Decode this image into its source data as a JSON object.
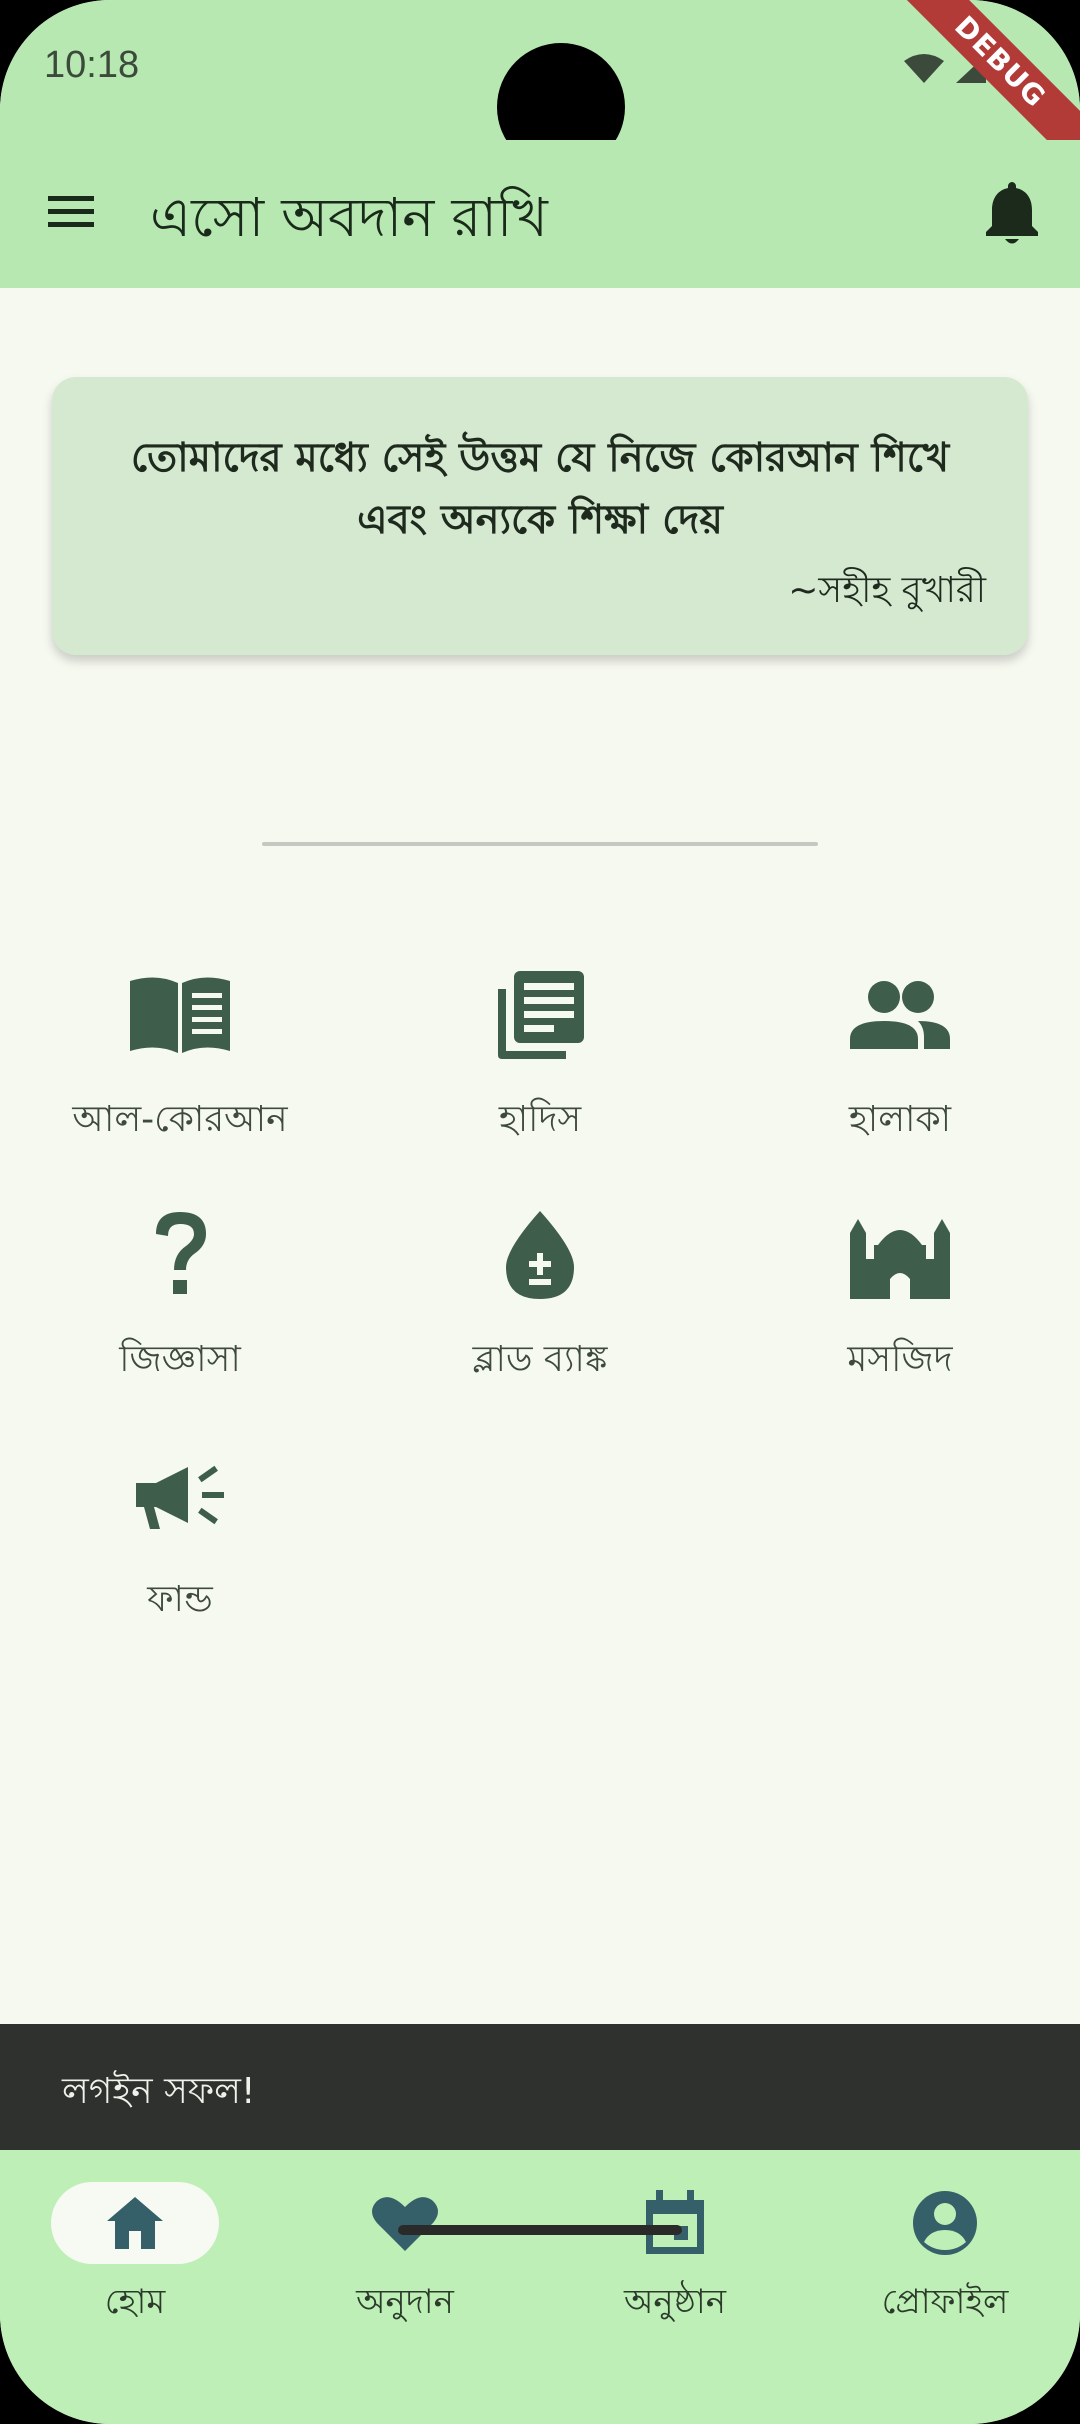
{
  "status_bar": {
    "time": "10:18",
    "debug_label": "DEBUG"
  },
  "app_bar": {
    "title": "এসো অবদান রাখি"
  },
  "quote": {
    "text": "তোমাদের মধ্যে সেই উত্তম যে নিজে কোরআন শিখে এবং অন্যকে শিক্ষা দেয়",
    "source": "~সহীহ বুখারী"
  },
  "grid": [
    {
      "label": "আল-কোরআন",
      "icon": "book-open-icon"
    },
    {
      "label": "হাদিস",
      "icon": "article-stack-icon"
    },
    {
      "label": "হালাকা",
      "icon": "people-icon"
    },
    {
      "label": "জিজ্ঞাসা",
      "icon": "question-mark-icon"
    },
    {
      "label": "ব্লাড ব্যাঙ্ক",
      "icon": "blood-drop-icon"
    },
    {
      "label": "মসজিদ",
      "icon": "mosque-icon"
    },
    {
      "label": "ফান্ড",
      "icon": "megaphone-icon"
    }
  ],
  "snackbar": {
    "text": "লগইন সফল!"
  },
  "bottom_nav": [
    {
      "label": "হোম",
      "icon": "home-icon",
      "active": true
    },
    {
      "label": "অনুদান",
      "icon": "heart-icon",
      "active": false
    },
    {
      "label": "অনুষ্ঠান",
      "icon": "calendar-icon",
      "active": false
    },
    {
      "label": "প্রোফাইল",
      "icon": "account-circle-icon",
      "active": false
    }
  ],
  "colors": {
    "app_bar": "#B7E8B1",
    "background": "#F6F9F0",
    "card": "#D5E8D0",
    "icon": "#3F5D4B",
    "nav_icon": "#35606A",
    "snackbar": "#2E312D",
    "debug": "#B23A37"
  }
}
